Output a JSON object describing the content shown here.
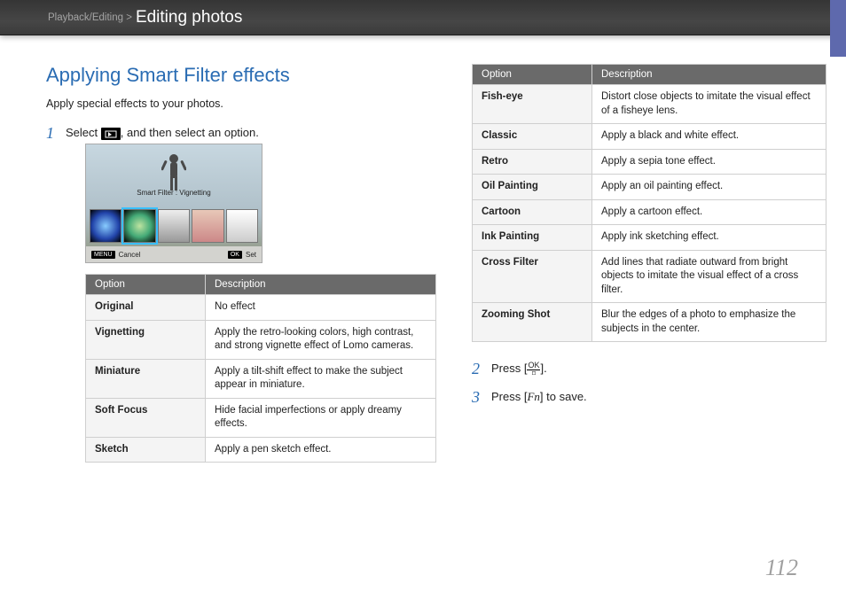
{
  "header": {
    "breadcrumb_root": "Playback/Editing >",
    "breadcrumb_leaf": "Editing photos"
  },
  "page_number": "112",
  "section": {
    "title": "Applying Smart Filter effects",
    "lead": "Apply special effects to your photos."
  },
  "steps": {
    "s1_pre": "Select ",
    "s1_post": ", and then select an option.",
    "s2_pre": "Press [",
    "s2_ok_top": "OK",
    "s2_ok_bot": "⌑",
    "s2_post": "].",
    "s3_pre": "Press [",
    "s3_fn": "Fn",
    "s3_post": "] to save."
  },
  "camera_screen": {
    "caption": "Smart Filter : Vignetting",
    "menu_btn": "MENU",
    "cancel": "Cancel",
    "ok_btn": "OK",
    "set": "Set"
  },
  "table_headers": {
    "option": "Option",
    "description": "Description"
  },
  "table_left": [
    {
      "opt": "Original",
      "desc": "No effect"
    },
    {
      "opt": "Vignetting",
      "desc": "Apply the retro-looking colors, high contrast, and strong vignette effect of Lomo cameras."
    },
    {
      "opt": "Miniature",
      "desc": "Apply a tilt-shift effect to make the subject appear in miniature."
    },
    {
      "opt": "Soft Focus",
      "desc": "Hide facial imperfections or apply dreamy effects."
    },
    {
      "opt": "Sketch",
      "desc": "Apply a pen sketch effect."
    }
  ],
  "table_right": [
    {
      "opt": "Fish-eye",
      "desc": "Distort close objects to imitate the visual effect of a fisheye lens."
    },
    {
      "opt": "Classic",
      "desc": "Apply a black and white effect."
    },
    {
      "opt": "Retro",
      "desc": "Apply a sepia tone effect."
    },
    {
      "opt": "Oil Painting",
      "desc": "Apply an oil painting effect."
    },
    {
      "opt": "Cartoon",
      "desc": "Apply a cartoon effect."
    },
    {
      "opt": "Ink Painting",
      "desc": "Apply ink sketching effect."
    },
    {
      "opt": "Cross Filter",
      "desc": "Add lines that radiate outward from bright objects to imitate the visual effect of a cross filter."
    },
    {
      "opt": "Zooming Shot",
      "desc": "Blur the edges of a photo to emphasize the subjects in the center."
    }
  ]
}
